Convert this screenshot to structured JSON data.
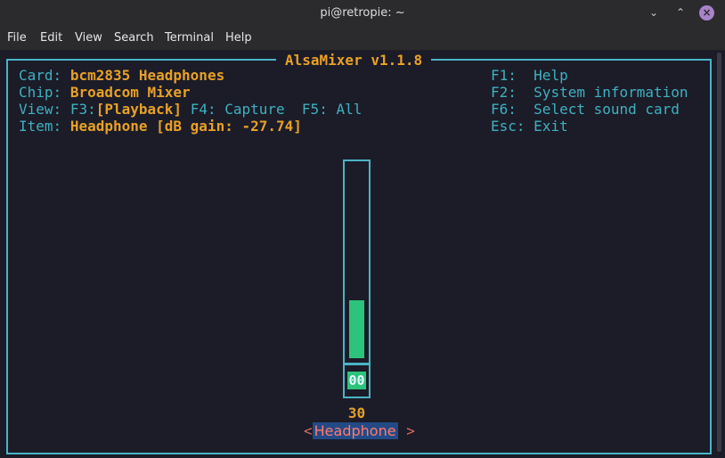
{
  "window": {
    "title": "pi@retropie: ~",
    "min_glyph": "⌄",
    "max_glyph": "⌃",
    "close_glyph": "×"
  },
  "menu": [
    "File",
    "Edit",
    "View",
    "Search",
    "Terminal",
    "Help"
  ],
  "alsamixer": {
    "title": "AlsaMixer v1.1.8",
    "card_label": "Card:",
    "card_value": "bcm2835 Headphones",
    "chip_label": "Chip:",
    "chip_value": "Broadcom Mixer",
    "view_label": "View:",
    "view_f3": "F3:",
    "view_playback": "[Playback]",
    "view_f4": "F4: Capture",
    "view_f5": "F5: All",
    "item_label": "Item:",
    "item_value": "Headphone [dB gain: -27.74]",
    "keys": [
      {
        "key": "F1:",
        "action": "Help"
      },
      {
        "key": "F2:",
        "action": "System information"
      },
      {
        "key": "F6:",
        "action": "Select sound card"
      },
      {
        "key": "Esc:",
        "action": "Exit"
      }
    ],
    "control": {
      "level": 0.3,
      "badge": "00",
      "volume": "30",
      "arrow_left": "<",
      "name": "Headphone",
      "arrow_right": ">"
    }
  },
  "colors": {
    "accent_cyan": "#4bb3c6",
    "label_cyan": "#3fb0c0",
    "value_orange": "#e8a027",
    "slider_green": "#2cc47a",
    "selection_blue": "#244a86"
  }
}
